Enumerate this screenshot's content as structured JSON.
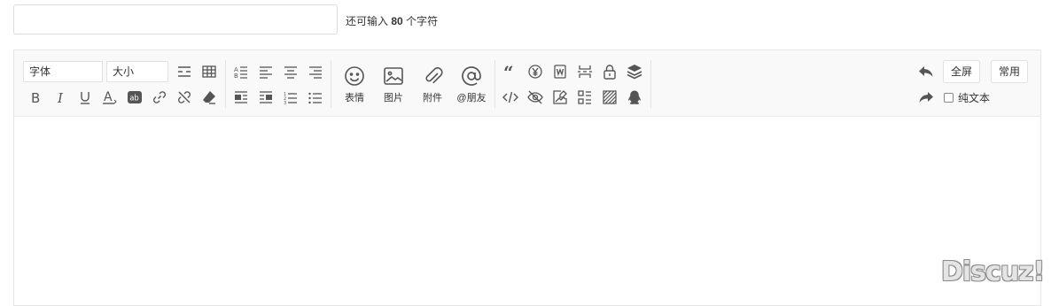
{
  "subject": {
    "value": "",
    "remain_prefix": "还可输入",
    "remain_count": "80",
    "remain_suffix": "个字符"
  },
  "toolbar": {
    "font_select": "字体",
    "size_select": "大小",
    "smiley_label": "表情",
    "image_label": "图片",
    "attach_label": "附件",
    "at_label": "@朋友",
    "fullscreen_label": "全屏",
    "common_label": "常用",
    "plaintext_label": "纯文本"
  },
  "logo": "Discuz!",
  "colors": {
    "icon": "#555555",
    "toolbar_bg": "#f9f9f9",
    "border": "#e6e6e6"
  }
}
